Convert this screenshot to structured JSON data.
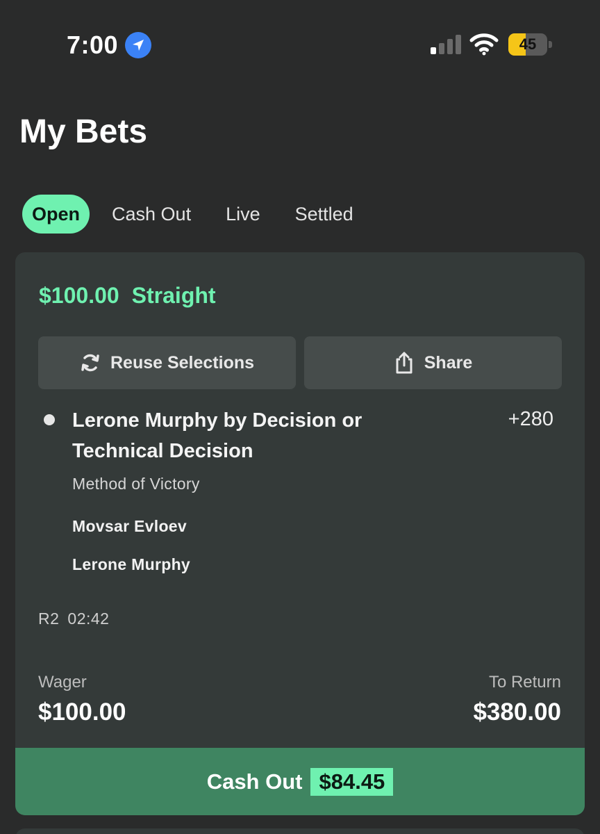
{
  "status_bar": {
    "time": "7:00",
    "battery_level": "45",
    "battery_fraction": 0.45,
    "icons": [
      "location-arrow-icon",
      "cellular-signal-icon",
      "wifi-icon",
      "battery-icon"
    ]
  },
  "page": {
    "title": "My Bets"
  },
  "tabs": [
    {
      "label": "Open",
      "active": true
    },
    {
      "label": "Cash Out",
      "active": false
    },
    {
      "label": "Live",
      "active": false
    },
    {
      "label": "Settled",
      "active": false
    }
  ],
  "bet": {
    "amount": "$100.00",
    "type": "Straight",
    "reuse_label": "Reuse Selections",
    "share_label": "Share",
    "selection": {
      "title": "Lerone Murphy by Decision or Technical Decision",
      "odds": "+280",
      "market": "Method of Victory",
      "fighter_1": "Movsar Evloev",
      "fighter_2": "Lerone Murphy"
    },
    "round": "R2",
    "clock": "02:42",
    "wager_label": "Wager",
    "wager_value": "$100.00",
    "return_label": "To Return",
    "return_value": "$380.00",
    "cashout_label": "Cash Out",
    "cashout_amount": "$84.45"
  },
  "colors": {
    "background": "#2a2b2b",
    "card": "#343a39",
    "accent_green": "#6ff1b0",
    "cashout_bar": "#3f8561",
    "battery_yellow": "#f5c518",
    "location_blue": "#3b82f6"
  }
}
